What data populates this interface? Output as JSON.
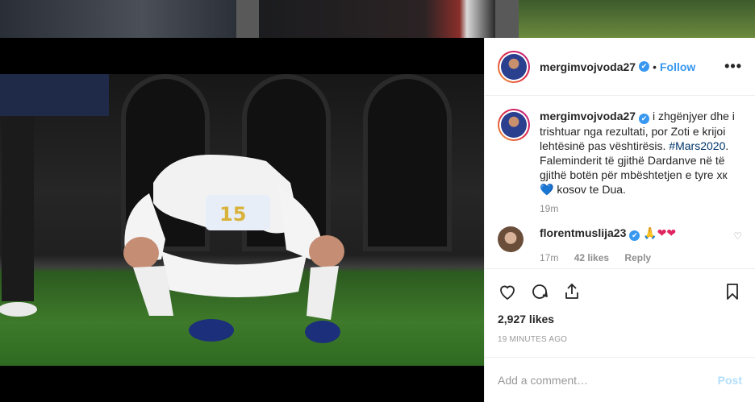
{
  "post": {
    "author": "mergimvojvoda27",
    "follow_label": "Follow",
    "more_label": "•••",
    "verified_mark": "✔"
  },
  "caption": {
    "username": "mergimvojvoda27",
    "text_1": "i zhgënjyer dhe i trishtuar nga rezultati, por Zoti e krijoi lehtësinë pas vështirësis.",
    "hashtag": "#Mars2020",
    "text_2": ". Faleminderit të gjithë Dardanve në të gjithë botën për mbështetjen e tyre xк",
    "heart": "💙",
    "text_3": "kosov te Dua.",
    "time": "19m"
  },
  "comment": {
    "username": "florentmuslija23",
    "emojis_pray": "🙏",
    "emojis_hearts": "❤❤",
    "time": "17m",
    "likes": "42 likes",
    "reply": "Reply",
    "like_icon": "♡"
  },
  "footer": {
    "likes": "2,927 likes",
    "timestamp": "19 MINUTES AGO",
    "comment_placeholder": "Add a comment…",
    "post_label": "Post"
  },
  "icons": {
    "like": "heart-icon",
    "comment": "comment-icon",
    "share": "share-icon",
    "save": "bookmark-icon"
  }
}
